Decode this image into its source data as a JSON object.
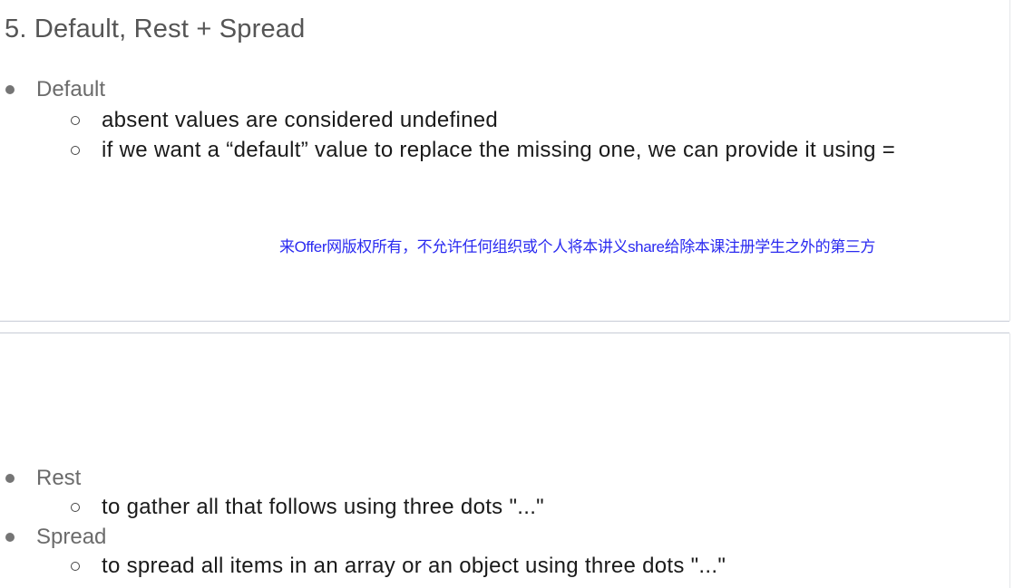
{
  "slide": {
    "title": "5. Default, Rest + Spread"
  },
  "sections": {
    "default": {
      "label": "Default",
      "items": [
        "absent values are considered undefined",
        "if we want a “default” value to replace the missing one, we can provide it using ="
      ]
    },
    "rest": {
      "label": "Rest",
      "items": [
        "to gather all that follows using three dots \"...\""
      ]
    },
    "spread": {
      "label": "Spread",
      "items": [
        "to spread all items in an array or an object using three dots \"...\""
      ]
    }
  },
  "watermark": {
    "text": "来Offer网版权所有，不允许任何组织或个人将本讲义share给除本课注册学生之外的第三方"
  },
  "colors": {
    "title": "#555555",
    "bullet_label": "#6b6b6b",
    "body_text": "#1a1a1a",
    "watermark": "#2a2af0",
    "divider": "#c7ccd6"
  }
}
